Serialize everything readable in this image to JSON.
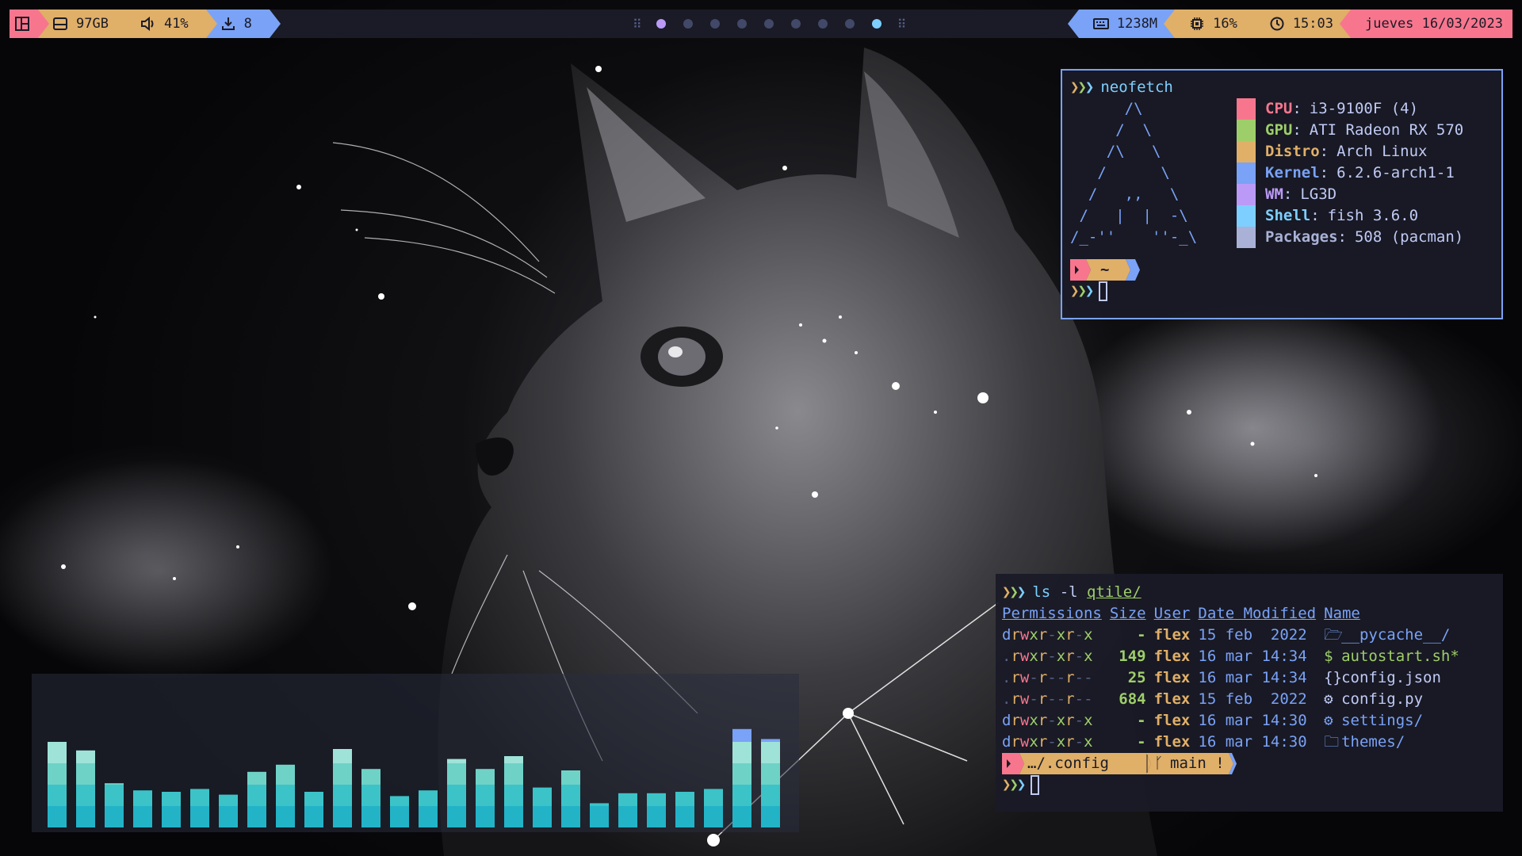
{
  "topbar": {
    "left_segments": [
      {
        "icon": "disk-icon",
        "text": "97GB",
        "color": "#e0af68"
      },
      {
        "icon": "volume-icon",
        "text": "41%",
        "color": "#e0af68"
      },
      {
        "icon": "download-icon",
        "text": "8",
        "color": "#7aa2f7"
      }
    ],
    "layout_color": "#f7768e",
    "groups": {
      "count": 9,
      "active_index": 8
    },
    "right_segments": [
      {
        "icon": "keyboard-memory-icon",
        "text": "1238M",
        "color": "#7aa2f7"
      },
      {
        "icon": "cpu-icon",
        "text": "16%",
        "color": "#e0af68"
      },
      {
        "icon": "clock-icon",
        "text": "15:03",
        "color": "#e0af68"
      },
      {
        "icon": "calendar-icon",
        "text": "jueves 16/03/2023",
        "color": "#f7768e"
      }
    ]
  },
  "neofetch": {
    "command": "neofetch",
    "ascii_art": "      /\\\n     /  \\\n    /\\   \\\n   /      \\\n  /   ,,   \\\n /   |  |  -\\\n/_-''    ''-_\\",
    "info": [
      {
        "key": "CPU",
        "value": "i3-9100F (4)",
        "color": "#f7768e"
      },
      {
        "key": "GPU",
        "value": "ATI Radeon RX 570",
        "color": "#9ece6a"
      },
      {
        "key": "Distro",
        "value": "Arch Linux",
        "color": "#e0af68"
      },
      {
        "key": "Kernel",
        "value": "6.2.6-arch1-1",
        "color": "#7aa2f7"
      },
      {
        "key": "WM",
        "value": "LG3D",
        "color": "#bb9af7"
      },
      {
        "key": "Shell",
        "value": "fish 3.6.0",
        "color": "#7dcfff"
      },
      {
        "key": "Packages",
        "value": "508 (pacman)",
        "color": "#a9b1d6"
      }
    ],
    "prompt_dir": "~"
  },
  "ls_terminal": {
    "command": "ls",
    "flag": "-l",
    "arg": "qtile/",
    "headers": [
      "Permissions",
      "Size",
      "User",
      "Date Modified",
      "Name"
    ],
    "rows": [
      {
        "perm": "drwxr-xr-x",
        "size": "-",
        "user": "flex",
        "date": "15 feb  2022",
        "icon": "folder-open-icon",
        "glyph": "🗁",
        "name": "__pycache__/",
        "kind": "dir"
      },
      {
        "perm": ".rwxr-xr-x",
        "size": "149",
        "user": "flex",
        "date": "16 mar 14:34",
        "icon": "shell-script-icon",
        "glyph": "$",
        "name": "autostart.sh*",
        "kind": "exe"
      },
      {
        "perm": ".rw-r--r--",
        "size": "25",
        "user": "flex",
        "date": "16 mar 14:34",
        "icon": "json-icon",
        "glyph": "{}",
        "name": "config.json",
        "kind": "file"
      },
      {
        "perm": ".rw-r--r--",
        "size": "684",
        "user": "flex",
        "date": "15 feb  2022",
        "icon": "python-icon",
        "glyph": "⚙",
        "name": "config.py",
        "kind": "file"
      },
      {
        "perm": "drwxr-xr-x",
        "size": "-",
        "user": "flex",
        "date": "16 mar 14:30",
        "icon": "settings-folder-icon",
        "glyph": "⚙",
        "name": "settings/",
        "kind": "dir"
      },
      {
        "perm": "drwxr-xr-x",
        "size": "-",
        "user": "flex",
        "date": "16 mar 14:30",
        "icon": "folder-icon",
        "glyph": "🗀",
        "name": "themes/",
        "kind": "dir"
      }
    ],
    "prompt_path": "…/.config",
    "git_branch": "main !"
  },
  "visualizer": {
    "levels": [
      0.6,
      0.54,
      0.31,
      0.26,
      0.25,
      0.27,
      0.23,
      0.39,
      0.44,
      0.25,
      0.55,
      0.41,
      0.22,
      0.26,
      0.48,
      0.41,
      0.5,
      0.28,
      0.4,
      0.17,
      0.24,
      0.24,
      0.25,
      0.27,
      0.69,
      0.62
    ],
    "colors": [
      "#22b3c7",
      "#3cc3c8",
      "#6fd2c7",
      "#9fe3d8",
      "#7aa2f7",
      "#b48ee8"
    ]
  }
}
